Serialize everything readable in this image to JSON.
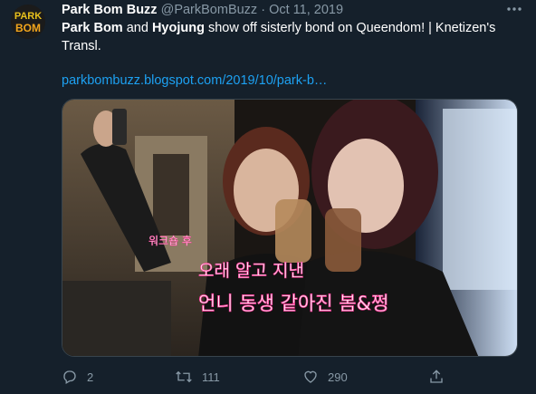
{
  "account": {
    "display_name": "Park Bom Buzz",
    "handle": "@ParkBomBuzz",
    "separator": "·",
    "date": "Oct 11, 2019",
    "avatar_text_line1": "PARK",
    "avatar_text_line2": "BOM"
  },
  "tweet": {
    "name1": "Park Bom",
    "and": " and ",
    "name2": "Hyojung",
    "text_rest": " show off sisterly bond on Queendom! | Knetizen's Transl.",
    "link": "parkbombuzz.blogspot.com/2019/10/park-b…"
  },
  "media": {
    "caption_line1": "워크숍 후",
    "caption_line2": "오래 알고 지낸",
    "caption_line3": "언니 동생 같아진 봄&쩡"
  },
  "actions": {
    "replies": "2",
    "retweets": "111",
    "likes": "290"
  },
  "colors": {
    "background": "#15202b",
    "muted": "#8899a6",
    "link": "#1da1f2"
  },
  "icons": [
    "more-icon",
    "reply-icon",
    "retweet-icon",
    "like-icon",
    "share-icon"
  ]
}
